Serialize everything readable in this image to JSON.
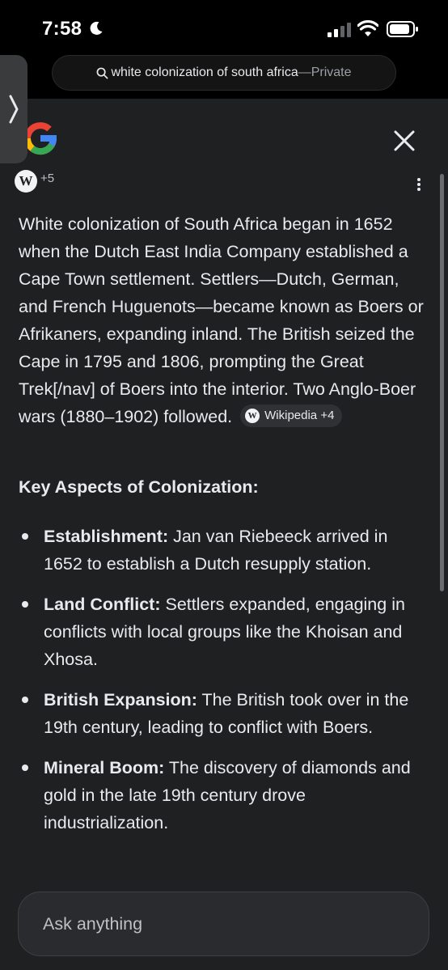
{
  "status_bar": {
    "time": "7:58",
    "icons": [
      "moon-icon",
      "signal-icon",
      "wifi-icon",
      "battery-icon"
    ]
  },
  "browser": {
    "url_query": "white colonization of south africa",
    "separator": " — ",
    "mode": "Private"
  },
  "header": {
    "logo_icon": "google-g-icon",
    "close_icon": "close-icon"
  },
  "sources": {
    "badge": "W",
    "count": "+5"
  },
  "answer": {
    "intro": "White colonization of South Africa began in 1652 when the Dutch East India Company established a Cape Town settlement. Settlers—Dutch, German, and French Huguenots—became known as Boers or Afrikaners, expanding inland. The British seized the Cape in 1795 and 1806, prompting the Great Trek[/nav] of Boers into the interior. Two Anglo-Boer wars (1880–1902) followed.",
    "citation": {
      "badge": "W",
      "label": "Wikipedia +4"
    },
    "section_heading": "Key Aspects of Colonization:",
    "bullets": [
      {
        "title": "Establishment:",
        "text": " Jan van Riebeeck arrived in 1652 to establish a Dutch resupply station."
      },
      {
        "title": "Land Conflict:",
        "text": " Settlers expanded, engaging in conflicts with local groups like the Khoisan and Xhosa."
      },
      {
        "title": "British Expansion:",
        "text": " The British took over in the 19th century, leading to conflict with Boers."
      },
      {
        "title": "Mineral Boom:",
        "text": " The discovery of diamonds and gold in the late 19th century drove industrialization."
      }
    ]
  },
  "ask_bar": {
    "placeholder": "Ask anything"
  },
  "colors": {
    "background": "#1f2022",
    "text": "#e8eaed",
    "muted": "#9aa0a6",
    "chip": "#303134"
  }
}
